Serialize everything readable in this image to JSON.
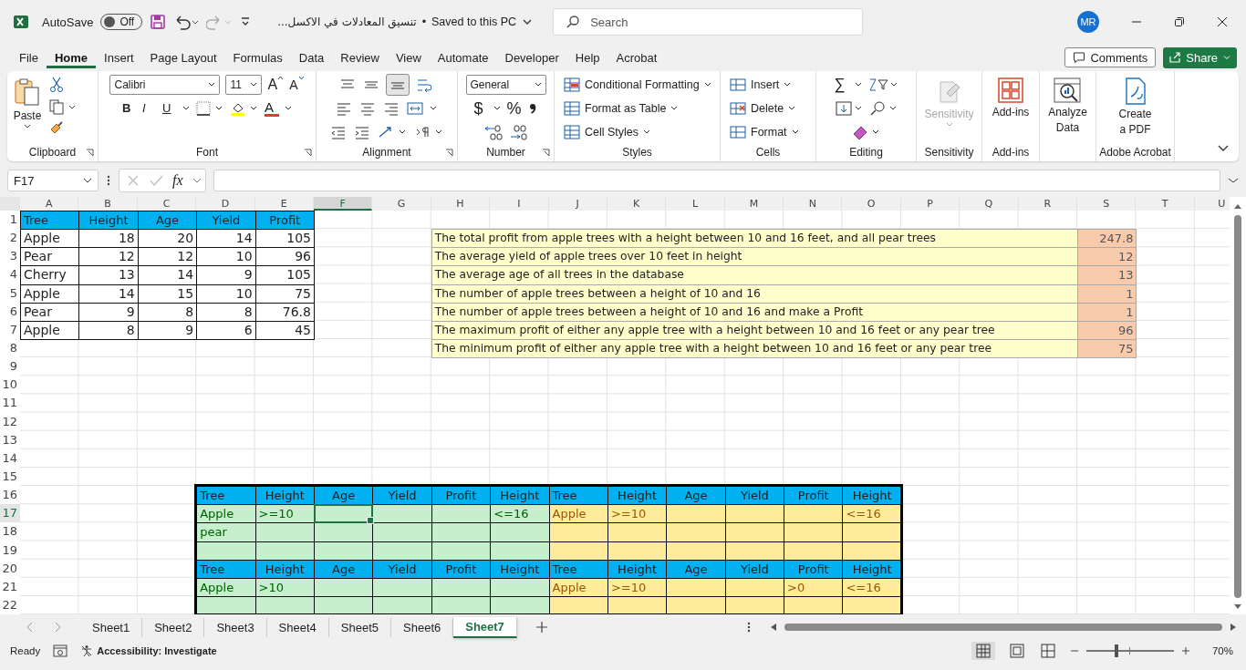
{
  "title_bar": {
    "autosave_label": "AutoSave",
    "autosave": {
      "label": "Off",
      "on": false
    },
    "document_title": "تنسيق المعادلات في الاكسل...",
    "separator": "•",
    "save_status": "Saved to this PC",
    "search_placeholder": "Search",
    "user_initials": "MR"
  },
  "menu_tabs": [
    {
      "label": "File",
      "selected": false
    },
    {
      "label": "Home",
      "selected": true
    },
    {
      "label": "Insert",
      "selected": false
    },
    {
      "label": "Page Layout",
      "selected": false
    },
    {
      "label": "Formulas",
      "selected": false
    },
    {
      "label": "Data",
      "selected": false
    },
    {
      "label": "Review",
      "selected": false
    },
    {
      "label": "View",
      "selected": false
    },
    {
      "label": "Automate",
      "selected": false
    },
    {
      "label": "Developer",
      "selected": false
    },
    {
      "label": "Help",
      "selected": false
    },
    {
      "label": "Acrobat",
      "selected": false
    }
  ],
  "header_buttons": {
    "comments": "Comments",
    "share": "Share"
  },
  "ribbon": {
    "clipboard": {
      "paste": "Paste",
      "label": "Clipboard"
    },
    "font": {
      "family": "Calibri",
      "size": "11",
      "grow": "A",
      "shrink": "A",
      "bold": "B",
      "italic": "I",
      "underline": "U",
      "font_color": "A",
      "label": "Font"
    },
    "alignment": {
      "bottom_align": {
        "selected": true
      },
      "label": "Alignment"
    },
    "number": {
      "format": "General",
      "currency": "$",
      "percent": "%",
      "label": "Number"
    },
    "styles": {
      "buttons": [
        "Conditional Formatting",
        "Format as Table",
        "Cell Styles"
      ],
      "label": "Styles"
    },
    "cells": {
      "buttons": [
        "Insert",
        "Delete",
        "Format"
      ],
      "label": "Cells"
    },
    "editing": {
      "sum": "∑",
      "label": "Editing"
    },
    "sensitivity": {
      "button": "Sensitivity",
      "disabled": true,
      "label": "Sensitivity"
    },
    "addins": {
      "button": "Add-ins",
      "label": "Add-ins"
    },
    "analyze": {
      "lines": [
        "Analyze",
        "Data"
      ]
    },
    "acrobat": {
      "lines": [
        "Create",
        "a PDF"
      ],
      "label": "Adobe Acrobat"
    }
  },
  "formula_bar": {
    "name_box": "F17",
    "fx": "fx"
  },
  "grid_columns": [
    {
      "label": "A",
      "selected": false
    },
    {
      "label": "B",
      "selected": false
    },
    {
      "label": "C",
      "selected": false
    },
    {
      "label": "D",
      "selected": false
    },
    {
      "label": "E",
      "selected": false
    },
    {
      "label": "F",
      "selected": true
    },
    {
      "label": "G",
      "selected": false
    },
    {
      "label": "H",
      "selected": false
    },
    {
      "label": "I",
      "selected": false
    },
    {
      "label": "J",
      "selected": false
    },
    {
      "label": "K",
      "selected": false
    },
    {
      "label": "L",
      "selected": false
    },
    {
      "label": "M",
      "selected": false
    },
    {
      "label": "N",
      "selected": false
    },
    {
      "label": "O",
      "selected": false
    },
    {
      "label": "P",
      "selected": false
    },
    {
      "label": "Q",
      "selected": false
    },
    {
      "label": "R",
      "selected": false
    },
    {
      "label": "S",
      "selected": false
    },
    {
      "label": "T",
      "selected": false
    },
    {
      "label": "U",
      "selected": false
    }
  ],
  "grid_rows": [
    {
      "label": "1",
      "selected": false
    },
    {
      "label": "2",
      "selected": false
    },
    {
      "label": "3",
      "selected": false
    },
    {
      "label": "4",
      "selected": false
    },
    {
      "label": "5",
      "selected": false
    },
    {
      "label": "6",
      "selected": false
    },
    {
      "label": "7",
      "selected": false
    },
    {
      "label": "8",
      "selected": false
    },
    {
      "label": "9",
      "selected": false
    },
    {
      "label": "10",
      "selected": false
    },
    {
      "label": "11",
      "selected": false
    },
    {
      "label": "12",
      "selected": false
    },
    {
      "label": "13",
      "selected": false
    },
    {
      "label": "14",
      "selected": false
    },
    {
      "label": "15",
      "selected": false
    },
    {
      "label": "16",
      "selected": false
    },
    {
      "label": "17",
      "selected": true
    },
    {
      "label": "18",
      "selected": false
    },
    {
      "label": "19",
      "selected": false
    },
    {
      "label": "20",
      "selected": false
    },
    {
      "label": "21",
      "selected": false
    },
    {
      "label": "22",
      "selected": false
    }
  ],
  "data_table": {
    "headers": [
      "Tree",
      "Height",
      "Age",
      "Yield",
      "Profit"
    ],
    "rows": [
      [
        "Apple",
        "18",
        "20",
        "14",
        "105"
      ],
      [
        "Pear",
        "12",
        "12",
        "10",
        "96"
      ],
      [
        "Cherry",
        "13",
        "14",
        "9",
        "105"
      ],
      [
        "Apple",
        "14",
        "15",
        "10",
        "75"
      ],
      [
        "Pear",
        "9",
        "8",
        "8",
        "76.8"
      ],
      [
        "Apple",
        "8",
        "9",
        "6",
        "45"
      ]
    ]
  },
  "summary": [
    {
      "label": "The total profit from apple trees with a height between 10 and 16 feet, and all pear trees",
      "value": "247.8"
    },
    {
      "label": "The average yield of apple trees over 10 feet in height",
      "value": "12"
    },
    {
      "label": "The average age of all trees in the database",
      "value": "13"
    },
    {
      "label": "The number of apple trees between a height of 10 and 16",
      "value": "1"
    },
    {
      "label": "The number of apple trees between a height of 10 and 16 and make a Profit",
      "value": "1"
    },
    {
      "label": "The maximum profit of either any apple tree with a height between 10 and 16 feet or any pear tree",
      "value": "96"
    },
    {
      "label": "The minimum profit of either any apple tree with a height between 10 and 16 feet or any pear tree",
      "value": "75"
    }
  ],
  "criteria_blocks": [
    {
      "kind": "good",
      "headers": [
        "Tree",
        "Height",
        "Age",
        "Yield",
        "Profit",
        "Height"
      ],
      "rows": [
        [
          "Apple",
          ">=10",
          null,
          null,
          null,
          "<=16"
        ],
        [
          "pear",
          null,
          null,
          null,
          null,
          null
        ],
        [
          null,
          null,
          null,
          null,
          null,
          null
        ]
      ]
    },
    {
      "kind": "neutral",
      "headers": [
        "Tree",
        "Height",
        "Age",
        "Yield",
        "Profit",
        "Height"
      ],
      "rows": [
        [
          "Apple",
          ">=10",
          null,
          null,
          null,
          "<=16"
        ],
        [
          null,
          null,
          null,
          null,
          null,
          null
        ],
        [
          null,
          null,
          null,
          null,
          null,
          null
        ]
      ]
    },
    {
      "kind": "good",
      "headers": [
        "Tree",
        "Height",
        "Age",
        "Yield",
        "Profit",
        "Height"
      ],
      "rows": [
        [
          "Apple",
          ">10",
          null,
          null,
          null,
          null
        ],
        [
          null,
          null,
          null,
          null,
          null,
          null
        ]
      ]
    },
    {
      "kind": "neutral",
      "headers": [
        "Tree",
        "Height",
        "Age",
        "Yield",
        "Profit",
        "Height"
      ],
      "rows": [
        [
          "Apple",
          ">=10",
          null,
          null,
          ">0",
          "<=16"
        ],
        [
          null,
          null,
          null,
          null,
          null,
          null
        ]
      ]
    }
  ],
  "sheet_tabs": [
    {
      "label": "Sheet1",
      "selected": false
    },
    {
      "label": "Sheet2",
      "selected": false
    },
    {
      "label": "Sheet3",
      "selected": false
    },
    {
      "label": "Sheet4",
      "selected": false
    },
    {
      "label": "Sheet5",
      "selected": false
    },
    {
      "label": "Sheet6",
      "selected": false
    },
    {
      "label": "Sheet7",
      "selected": true
    }
  ],
  "status_bar": {
    "mode": "Ready",
    "accessibility": "Accessibility: Investigate",
    "zoom": {
      "level": 0.34
    },
    "zoom_text": "70%"
  }
}
